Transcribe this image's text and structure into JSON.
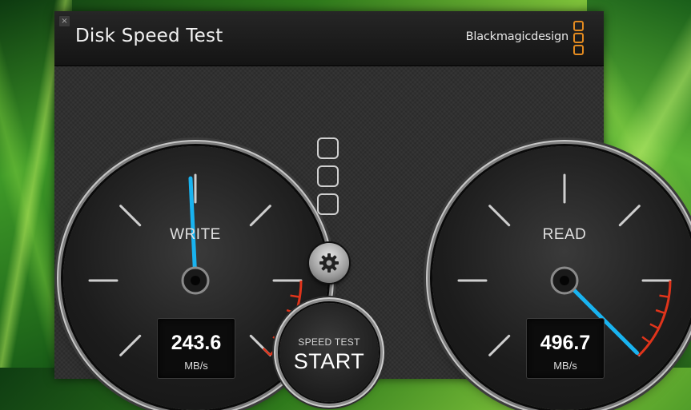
{
  "window": {
    "close_glyph": "×",
    "title": "Disk Speed Test",
    "brand": "Blackmagicdesign"
  },
  "gauges": {
    "write": {
      "label": "WRITE",
      "value": "243.6",
      "unit": "MB/s",
      "needle_fraction": 0.49
    },
    "read": {
      "label": "READ",
      "value": "496.7",
      "unit": "MB/s",
      "needle_fraction": 1.0
    }
  },
  "controls": {
    "settings_icon": "gear-icon",
    "start_caption": "SPEED TEST",
    "start_label": "START"
  },
  "colors": {
    "needle": "#19b3f0",
    "redline": "#e0341b",
    "brand_logo": "#e28a20"
  }
}
